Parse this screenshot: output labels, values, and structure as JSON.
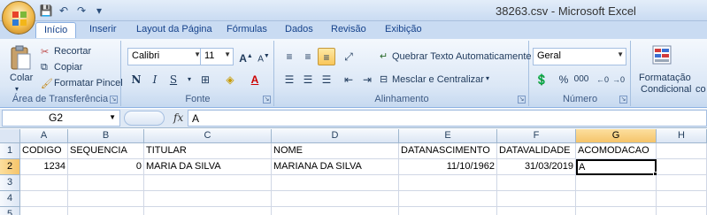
{
  "window": {
    "title": "38263.csv - Microsoft Excel"
  },
  "quick_access": [
    {
      "name": "save-icon",
      "glyph": "💾"
    },
    {
      "name": "undo-icon",
      "glyph": "↶"
    },
    {
      "name": "redo-icon",
      "glyph": "↷"
    },
    {
      "name": "customize-icon",
      "glyph": "▾"
    }
  ],
  "tabs": [
    "Início",
    "Inserir",
    "Layout da Página",
    "Fórmulas",
    "Dados",
    "Revisão",
    "Exibição"
  ],
  "ribbon": {
    "clipboard": {
      "paste": "Colar",
      "cut": "Recortar",
      "copy": "Copiar",
      "format_painter": "Formatar Pincel",
      "label": "Área de Transferência"
    },
    "font": {
      "name": "Calibri",
      "size": "11",
      "bold": "N",
      "italic": "I",
      "underline": "S",
      "label": "Fonte"
    },
    "alignment": {
      "wrap": "Quebrar Texto Automaticamente",
      "merge": "Mesclar e Centralizar",
      "label": "Alinhamento"
    },
    "number": {
      "format": "Geral",
      "percent": "%",
      "thousands": "000",
      "label": "Número"
    },
    "styles": {
      "conditional_line1": "Formatação",
      "conditional_line2": "Condicional",
      "extra": "co"
    }
  },
  "formula_bar": {
    "cell_ref": "G2",
    "fx": "fx",
    "value": "A"
  },
  "sheet": {
    "columns": [
      "A",
      "B",
      "C",
      "D",
      "E",
      "F",
      "G",
      "H"
    ],
    "rows": [
      "1",
      "2",
      "3",
      "4",
      "5"
    ],
    "row1": [
      "CODIGO",
      "SEQUENCIA",
      "TITULAR",
      "NOME",
      "DATANASCIMENTO",
      "DATAVALIDADE",
      "ACOMODACAO",
      ""
    ],
    "row2": [
      "1234",
      "0",
      "MARIA DA SILVA",
      "MARIANA DA SILVA",
      "11/10/1962",
      "31/03/2019",
      "A",
      ""
    ],
    "selected_cell": "G2"
  },
  "colors": {
    "accent": "#15428b",
    "ribbon_bg": "#dbe7f6",
    "selection": "#f5c46a"
  }
}
